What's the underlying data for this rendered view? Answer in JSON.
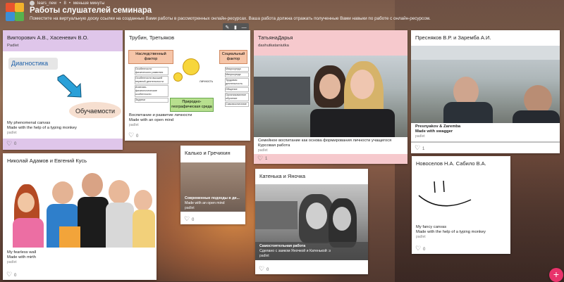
{
  "header": {
    "user": "lears_new",
    "dot": "•",
    "count": "8",
    "time": "меньше минуты",
    "title": "Работы слушателей семинара",
    "subtitle": "Поместите на виртуальную доску ссылки на созданные Вами работы в рассмотренных онлайн-ресурсах. Ваша работа должна отражать полученные Вами навыки по работе с онлайн-ресурсом."
  },
  "card_toolbar": {
    "edit_icon": "pencil-icon",
    "delete_icon": "trash-icon",
    "more_icon": "more-icon"
  },
  "cards": [
    {
      "author": "Викторович А.В., Хасеневич В.О.",
      "source_top": "Padlet",
      "image_labels": [
        "Диагностика",
        "Обучаемости"
      ],
      "caption": "My phenomenal canvas",
      "caption2": "Made with the help of a typing monkey",
      "src": "padlet",
      "likes": "0",
      "color": "#dfc6ea"
    },
    {
      "author": "Трубин, Третьяков",
      "image_labels": {
        "left_box": "Наследственный фактор",
        "right_box": "Социальный фактор",
        "bottom_box": "Природно-географическая среда",
        "center": "личность",
        "left_items": [
          "Особенности физического развития",
          "Особенности высшей нервной деятельности",
          "Анатомо-физиологические особенности",
          "Задатки"
        ],
        "right_items": [
          "Макросреда",
          "Микросреда",
          "Трудовая деятельность",
          "Общение",
          "Организованное обучение",
          "Самовоспитание"
        ]
      },
      "caption": "Воспитание и развитие личности",
      "caption2": "Made with an open mind",
      "src": "padlet",
      "likes": "0"
    },
    {
      "author": "ТатьянаДарья",
      "source_top": "dashutkataniutka",
      "caption": "Семейное воспитание как основа формирования личности учащегося",
      "caption2": "Курсовая работа",
      "src": "padlet",
      "likes": "1",
      "color": "#f6c9cd"
    },
    {
      "author": "Пресняков В.Р. и Заремба А.И.",
      "caption": "Presnyakov & Zaremba",
      "caption2": "Made with swagger",
      "src": "padlet",
      "likes": "1"
    },
    {
      "author": "Николай Адамов и Евгений Кусь",
      "caption": "My fearless wall",
      "caption2": "Made with mirth",
      "src": "padlet",
      "likes": "0"
    },
    {
      "author": "Калько и Гречихин",
      "caption": "Современные подходы в ди...",
      "caption2": "Made with an open mind",
      "src": "padlet",
      "likes": "0"
    },
    {
      "author": "Катенька и Яночка",
      "caption": "Самостоятельная работа",
      "caption2": "Сделано с заиком Яночкой и Катенькой :з",
      "src": "padlet",
      "likes": "0"
    },
    {
      "author": "Новоселов Н.А. Сабило В.А.",
      "caption": "My fancy canvas",
      "caption2": "Made with the help of a typing monkey",
      "src": "padlet",
      "likes": "0"
    }
  ],
  "fab": {
    "label": "+"
  },
  "colors": {
    "accent": "#e8336b",
    "pink_card": "#f6c9cd",
    "purple_card": "#dfc6ea"
  }
}
